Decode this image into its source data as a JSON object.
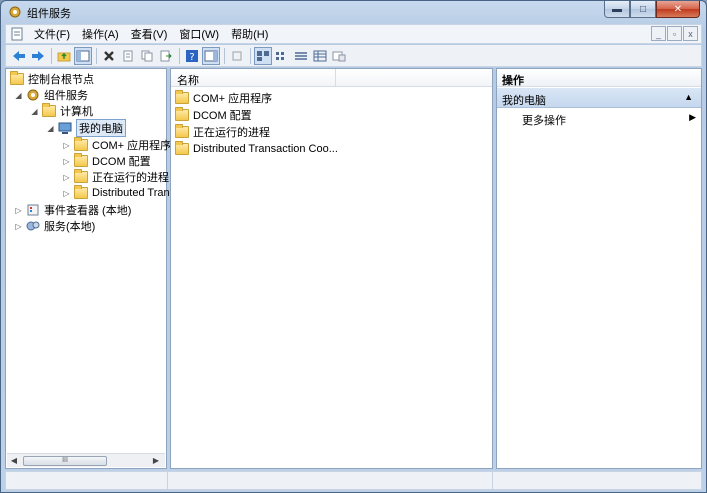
{
  "window": {
    "title": "组件服务"
  },
  "menubar": {
    "items": [
      "文件(F)",
      "操作(A)",
      "查看(V)",
      "窗口(W)",
      "帮助(H)"
    ]
  },
  "window_buttons": {
    "minimize": "▬",
    "maximize": "□",
    "close": "✕"
  },
  "mdi_buttons": {
    "minimize": "_",
    "restore": "▫",
    "close": "x"
  },
  "tree": {
    "root": "控制台根节点",
    "component_services": "组件服务",
    "computers": "计算机",
    "my_computer": "我的电脑",
    "children": [
      "COM+ 应用程序",
      "DCOM 配置",
      "正在运行的进程",
      "Distributed Tran"
    ],
    "event_viewer": "事件查看器 (本地)",
    "services": "服务(本地)",
    "scroll_thumb": "III"
  },
  "list": {
    "column_name": "名称",
    "items": [
      "COM+ 应用程序",
      "DCOM 配置",
      "正在运行的进程",
      "Distributed Transaction Coo..."
    ]
  },
  "actions": {
    "header": "操作",
    "section": "我的电脑",
    "more": "更多操作"
  },
  "colors": {
    "accent": "#c6d8ee",
    "folder": "#f4c84d",
    "close_button": "#c0391d"
  }
}
